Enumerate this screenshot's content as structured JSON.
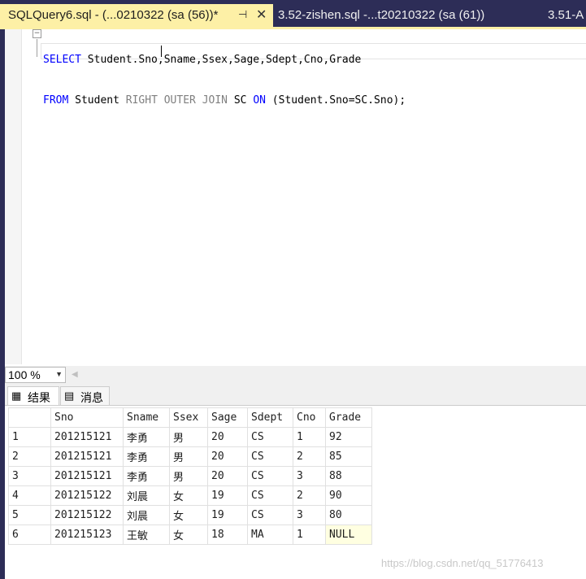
{
  "tabs": [
    {
      "label": "SQLQuery6.sql - (...0210322 (sa (56))*",
      "active": true
    },
    {
      "label": "3.52-zishen.sql -...t20210322 (sa (61))",
      "active": false
    },
    {
      "label": "3.51-A",
      "active": false
    }
  ],
  "tab_icons": {
    "pin": "⊣",
    "close": "✕"
  },
  "editor": {
    "line1": {
      "kw1": "SELECT",
      "rest": " Student.Sno,Sname,Ssex,Sage,Sdept,Cno,Grade"
    },
    "line2": {
      "kw1": "FROM",
      "mid1": " Student ",
      "kw2": "RIGHT",
      "mid2": " ",
      "g1": "OUTER",
      "mid3": " ",
      "g2": "JOIN",
      "mid4": " SC ",
      "kw3": "ON",
      "rest": " (Student.Sno=SC.Sno);"
    }
  },
  "zoom": {
    "value": "100 %"
  },
  "results_tabs": [
    {
      "icon": "grid-icon",
      "label": "结果"
    },
    {
      "icon": "message-icon",
      "label": "消息"
    }
  ],
  "grid": {
    "columns": [
      "",
      "Sno",
      "Sname",
      "Ssex",
      "Sage",
      "Sdept",
      "Cno",
      "Grade"
    ],
    "rows": [
      [
        "1",
        "201215121",
        "李勇",
        "男",
        "20",
        "CS",
        "1",
        "92"
      ],
      [
        "2",
        "201215121",
        "李勇",
        "男",
        "20",
        "CS",
        "2",
        "85"
      ],
      [
        "3",
        "201215121",
        "李勇",
        "男",
        "20",
        "CS",
        "3",
        "88"
      ],
      [
        "4",
        "201215122",
        "刘晨",
        "女",
        "19",
        "CS",
        "2",
        "90"
      ],
      [
        "5",
        "201215122",
        "刘晨",
        "女",
        "19",
        "CS",
        "3",
        "80"
      ],
      [
        "6",
        "201215123",
        "王敏",
        "女",
        "18",
        "MA",
        "1",
        "NULL"
      ]
    ]
  },
  "watermark": "https://blog.csdn.net/qq_51776413",
  "colors": {
    "tabstrip": "#2d2d57",
    "active_tab": "#fdf0a6",
    "keyword": "#0000ff",
    "null_cell": "#ffffe1"
  }
}
